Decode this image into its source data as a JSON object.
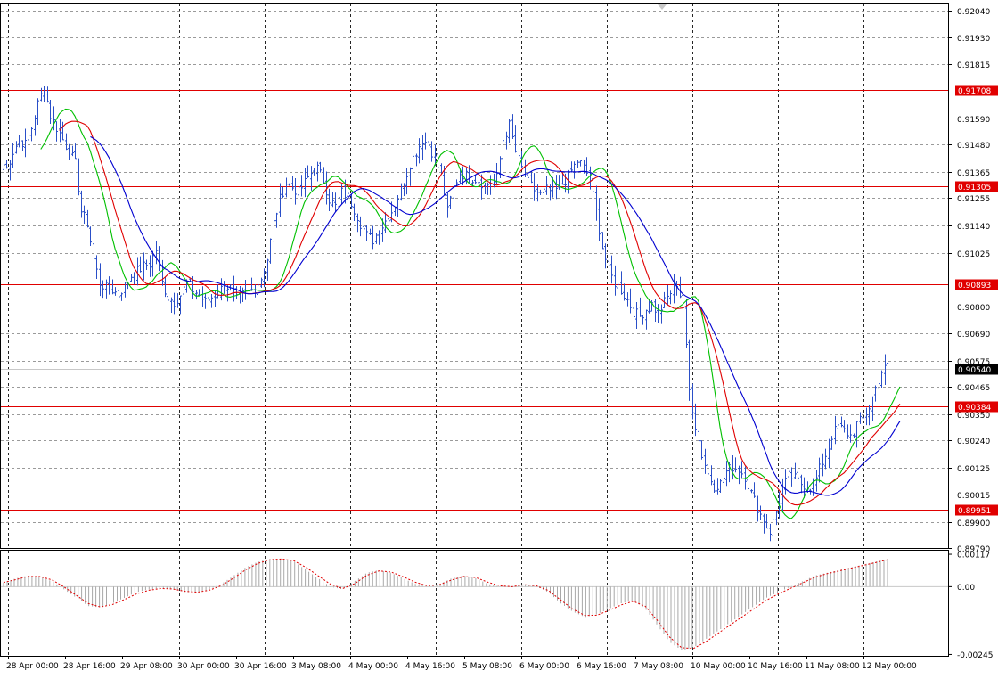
{
  "chart_data": {
    "type": "candlestick",
    "y_range": [
      0.8979,
      0.9207
    ],
    "osc_range": [
      -0.0025,
      0.0013
    ],
    "price_ticks": [
      "0.92040",
      "0.91930",
      "0.91815",
      "0.91708",
      "0.91590",
      "0.91480",
      "0.91365",
      "0.91305",
      "0.91255",
      "0.91140",
      "0.91025",
      "0.90893",
      "0.90800",
      "0.90690",
      "0.90575",
      "0.90540",
      "0.90465",
      "0.90384",
      "0.90350",
      "0.90240",
      "0.90125",
      "0.90015",
      "0.89951",
      "0.89900",
      "0.89790"
    ],
    "osc_ticks": [
      "0.00117",
      "0.00",
      "-0.00245"
    ],
    "time_labels": [
      "28 Apr 00:00",
      "28 Apr 16:00",
      "29 Apr 08:00",
      "30 Apr 00:00",
      "30 Apr 16:00",
      "3 May 08:00",
      "4 May 00:00",
      "4 May 16:00",
      "5 May 08:00",
      "6 May 00:00",
      "6 May 16:00",
      "7 May 08:00",
      "10 May 00:00",
      "10 May 16:00",
      "11 May 08:00",
      "12 May 00:00"
    ],
    "horizontal_levels": [
      {
        "value": 0.91708,
        "label": "0.91708",
        "color": "#e00000"
      },
      {
        "value": 0.91305,
        "label": "0.91305",
        "color": "#e00000"
      },
      {
        "value": 0.90893,
        "label": "0.90893",
        "color": "#e00000"
      },
      {
        "value": 0.90384,
        "label": "0.90384",
        "color": "#e00000"
      },
      {
        "value": 0.89951,
        "label": "0.89951",
        "color": "#e00000"
      }
    ],
    "current_price": {
      "value": 0.9054,
      "label": "0.90540",
      "color": "#000000"
    },
    "price_path": [
      [
        0.9141,
        0.9138,
        0.9145,
        0.915,
        0.9148,
        0.9155,
        0.9165,
        0.9172,
        0.916,
        0.9155,
        0.915,
        0.9145,
        0.914,
        0.912,
        0.9115,
        0.91
      ],
      [
        0.909,
        0.9088,
        0.9087,
        0.9085,
        0.9089,
        0.9093,
        0.9095,
        0.9097,
        0.9098,
        0.9104,
        0.909,
        0.9084,
        0.9082,
        0.9085,
        0.909,
        0.9087
      ],
      [
        0.9085,
        0.9082,
        0.9084,
        0.9086,
        0.9089,
        0.9088,
        0.9083,
        0.9085,
        0.9086,
        0.9088,
        0.9092,
        0.91,
        0.9115,
        0.9125,
        0.9132,
        0.913
      ],
      [
        0.9128,
        0.9132,
        0.9136,
        0.9138,
        0.9133,
        0.9125,
        0.9122,
        0.9128,
        0.9126,
        0.9121,
        0.9115,
        0.911,
        0.9108,
        0.9112,
        0.9116,
        0.912
      ],
      [
        0.9126,
        0.9132,
        0.914,
        0.9145,
        0.915,
        0.9148,
        0.9142,
        0.9135,
        0.912,
        0.913,
        0.9136,
        0.9135,
        0.9134,
        0.9133,
        0.9131,
        0.9132
      ],
      [
        0.9134,
        0.915,
        0.9156,
        0.9145,
        0.9138,
        0.9132,
        0.9129,
        0.9127,
        0.9129,
        0.9128,
        0.913,
        0.9133,
        0.9137,
        0.9141,
        0.9139,
        0.9133
      ],
      [
        0.912,
        0.9105,
        0.9095,
        0.909,
        0.9087,
        0.9083,
        0.9078,
        0.9076,
        0.9079,
        0.9081,
        0.9077,
        0.9082,
        0.9086,
        0.909,
        0.908,
        0.9045
      ],
      [
        0.903,
        0.9018,
        0.901,
        0.9005,
        0.9006,
        0.9011,
        0.9013,
        0.9012,
        0.9009,
        0.9002,
        0.8996,
        0.899,
        0.8986,
        0.8994,
        0.9004,
        0.9009
      ],
      [
        0.9008,
        0.9006,
        0.9005,
        0.9004,
        0.9012,
        0.9018,
        0.9026,
        0.903,
        0.9028,
        0.9026,
        0.9031,
        0.9033,
        0.9038,
        0.9046,
        0.9053,
        0.9055
      ]
    ],
    "osc_values": [
      0.00015,
      0.0003,
      0.0004,
      0.00035,
      0.0002,
      -0.0001,
      -0.0004,
      -0.0007,
      -0.00075,
      -0.0006,
      -0.0004,
      -0.0002,
      -0.0001,
      -5e-05,
      -0.0001,
      -0.0002,
      -0.0002,
      -0.0001,
      0.0001,
      0.0004,
      0.0007,
      0.0009,
      0.001,
      0.001,
      0.0009,
      0.0006,
      0.0003,
      0.0,
      -0.0001,
      0.0002,
      0.0005,
      0.0006,
      0.0005,
      0.0003,
      0.0001,
      0.0,
      0.0001,
      0.0003,
      0.0004,
      0.0003,
      0.0001,
      0.0,
      0.0,
      0.0001,
      0.0,
      -0.0002,
      -0.0006,
      -0.0009,
      -0.0011,
      -0.001,
      -0.0008,
      -0.0006,
      -0.0005,
      -0.0008,
      -0.0014,
      -0.002,
      -0.0023,
      -0.0022,
      -0.0019,
      -0.0016,
      -0.0013,
      -0.001,
      -0.0007,
      -0.0004,
      -0.0002,
      0.0,
      0.0002,
      0.0004,
      0.0005,
      0.0006,
      0.0007,
      0.0008,
      0.0009,
      0.001
    ],
    "series": [
      {
        "name": "",
        "color": "#00c000",
        "period": 8
      },
      {
        "name": "",
        "color": "#e00000",
        "period": 14
      },
      {
        "name": "",
        "color": "#0000d0",
        "period": 24
      }
    ],
    "colors": {
      "candle": "#2a4fc8",
      "grid": "#9a9a9a",
      "axis_text": "#000000"
    }
  }
}
